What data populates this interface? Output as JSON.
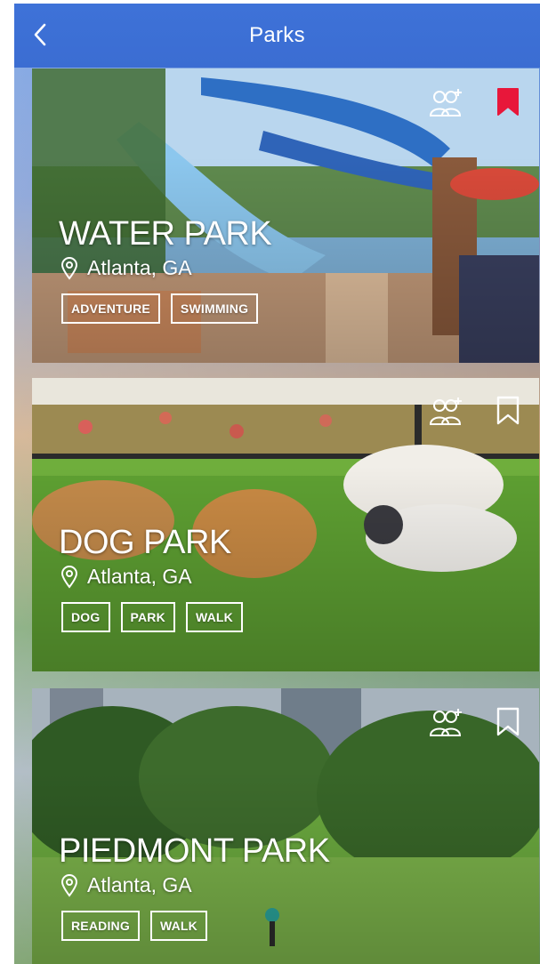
{
  "header": {
    "title": "Parks"
  },
  "colors": {
    "nav": "#3b6dd2",
    "bookmark_active": "#e8173a",
    "text": "#ffffff"
  },
  "cards": [
    {
      "title": "WATER PARK",
      "location": "Atlanta, GA",
      "tags": [
        "ADVENTURE",
        "SWIMMING"
      ],
      "bookmarked": true
    },
    {
      "title": "DOG PARK",
      "location": "Atlanta, GA",
      "tags": [
        "DOG",
        "PARK",
        "WALK"
      ],
      "bookmarked": false
    },
    {
      "title": "PIEDMONT PARK",
      "location": "Atlanta, GA",
      "tags": [
        "READING",
        "WALK"
      ],
      "bookmarked": false
    }
  ],
  "icons": {
    "back": "chevron-left-icon",
    "group": "group-add-icon",
    "bookmark": "bookmark-icon",
    "location": "location-pin-icon"
  }
}
